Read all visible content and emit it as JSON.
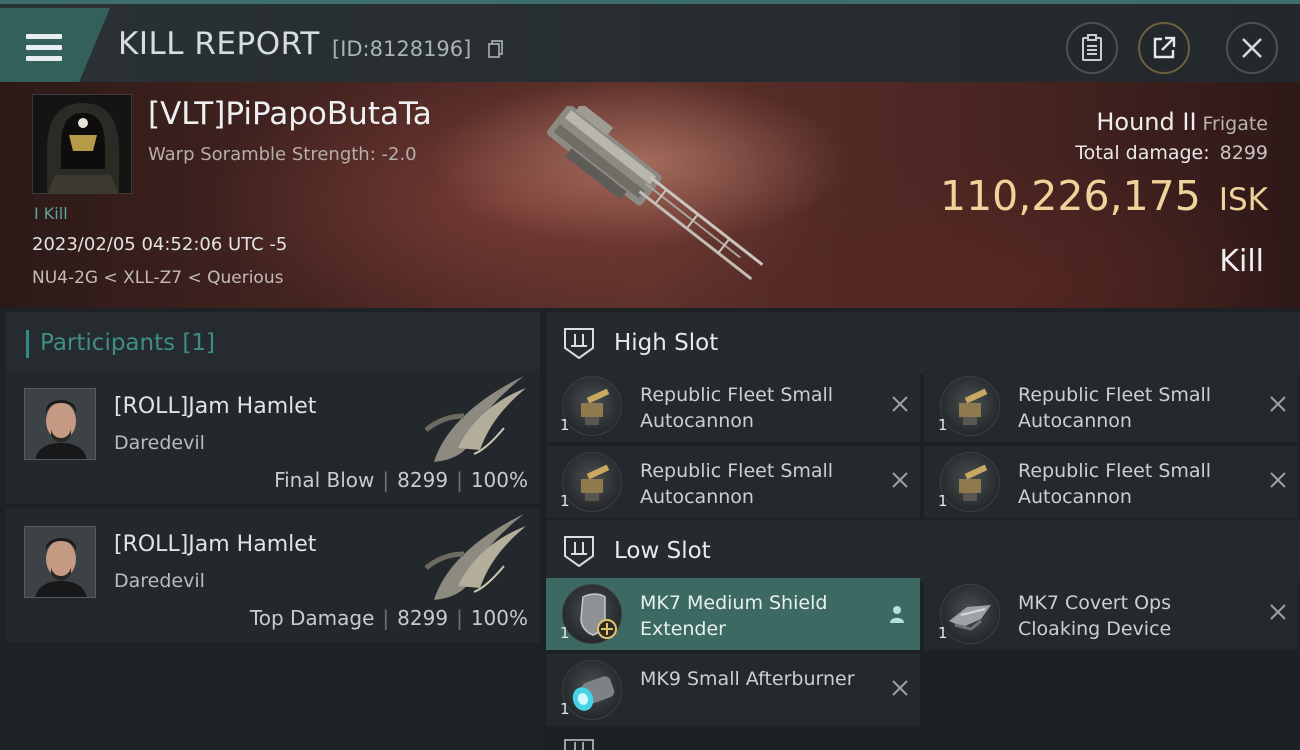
{
  "header": {
    "title": "KILL REPORT",
    "report_id": "[ID:8128196]",
    "menu_icon": "hamburger-menu-icon",
    "buttons": [
      "clipboard-icon",
      "share-icon",
      "close-icon"
    ]
  },
  "victim": {
    "pilot_name": "[VLT]PiPapoButaTa",
    "subtitle": "Warp Soramble Strength: -2.0",
    "kill_tag": "I Kill",
    "datetime": "2023/02/05 04:52:06 UTC -5",
    "location": "NU4-2G < XLL-Z7 < Querious",
    "ship_name": "Hound II",
    "ship_class": "Frigate",
    "total_damage_label": "Total damage:",
    "total_damage": "8299",
    "isk_value": "110,226,175",
    "isk_unit": "ISK",
    "result": "Kill"
  },
  "participants": {
    "label": "Participants",
    "count": "[1]",
    "rows": [
      {
        "name": "[ROLL]Jam Hamlet",
        "ship": "Daredevil",
        "role": "Final Blow",
        "damage": "8299",
        "percent": "100%"
      },
      {
        "name": "[ROLL]Jam Hamlet",
        "ship": "Daredevil",
        "role": "Top Damage",
        "damage": "8299",
        "percent": "100%"
      }
    ]
  },
  "slots": {
    "high": {
      "label": "High Slot",
      "modules": [
        {
          "name": "Republic Fleet Small Autocannon",
          "qty": "1"
        },
        {
          "name": "Republic Fleet Small Autocannon",
          "qty": "1"
        },
        {
          "name": "Republic Fleet Small Autocannon",
          "qty": "1"
        },
        {
          "name": "Republic Fleet Small Autocannon",
          "qty": "1"
        }
      ]
    },
    "low": {
      "label": "Low Slot",
      "modules": [
        {
          "name": "MK7 Medium Shield Extender",
          "qty": "1"
        },
        {
          "name": "MK7 Covert Ops Cloaking Device",
          "qty": "1"
        },
        {
          "name": "MK9 Small Afterburner",
          "qty": "1"
        }
      ]
    }
  },
  "colors": {
    "accent": "#33605a",
    "isk": "#efd39a",
    "highlight": "#3d6963"
  }
}
